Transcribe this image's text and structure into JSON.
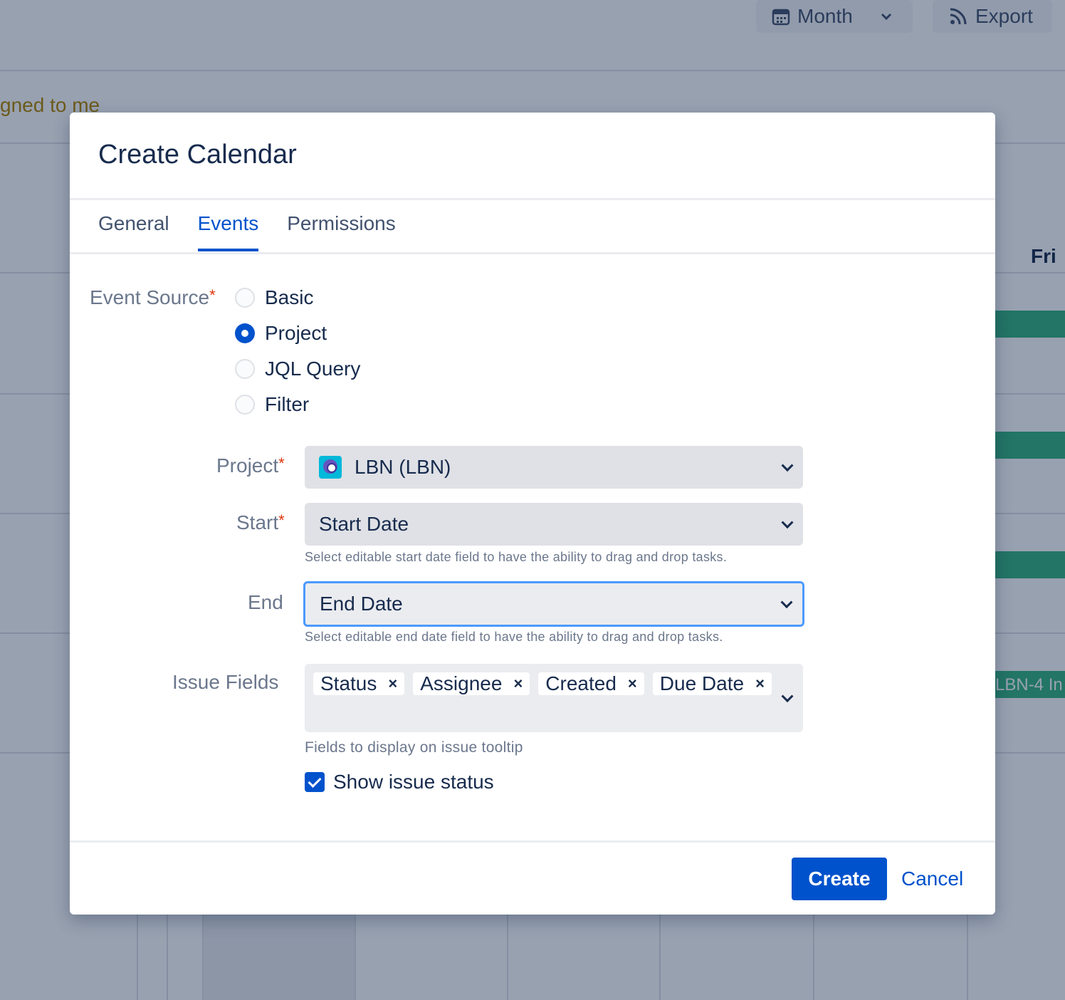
{
  "background": {
    "toolbar": {
      "month_label": "Month",
      "export_label": "Export"
    },
    "filter_text": "gned to me",
    "day_header": "Fri",
    "event_text": "LBN-4 In"
  },
  "modal": {
    "title": "Create Calendar",
    "tabs": [
      {
        "label": "General",
        "active": false
      },
      {
        "label": "Events",
        "active": true
      },
      {
        "label": "Permissions",
        "active": false
      }
    ],
    "event_source": {
      "label": "Event Source",
      "required_mark": "*",
      "options": [
        {
          "label": "Basic",
          "checked": false
        },
        {
          "label": "Project",
          "checked": true
        },
        {
          "label": "JQL Query",
          "checked": false
        },
        {
          "label": "Filter",
          "checked": false
        }
      ]
    },
    "project": {
      "label": "Project",
      "required_mark": "*",
      "value": "LBN (LBN)"
    },
    "start": {
      "label": "Start",
      "required_mark": "*",
      "value": "Start Date",
      "help": "Select editable start date field to have the ability to drag and drop tasks."
    },
    "end": {
      "label": "End",
      "value": "End Date",
      "help": "Select editable end date field to have the ability to drag and drop tasks."
    },
    "issue_fields": {
      "label": "Issue Fields",
      "tags": [
        "Status",
        "Assignee",
        "Created",
        "Due Date"
      ],
      "remove_glyph": "×",
      "help": "Fields to display on issue tooltip"
    },
    "show_status": {
      "label": "Show issue status",
      "checked": true
    },
    "footer": {
      "create_label": "Create",
      "cancel_label": "Cancel"
    }
  },
  "colors": {
    "primary": "#0052cc",
    "required": "#de350b",
    "event_bar": "#36b37e",
    "focus_ring": "#4c9aff"
  }
}
